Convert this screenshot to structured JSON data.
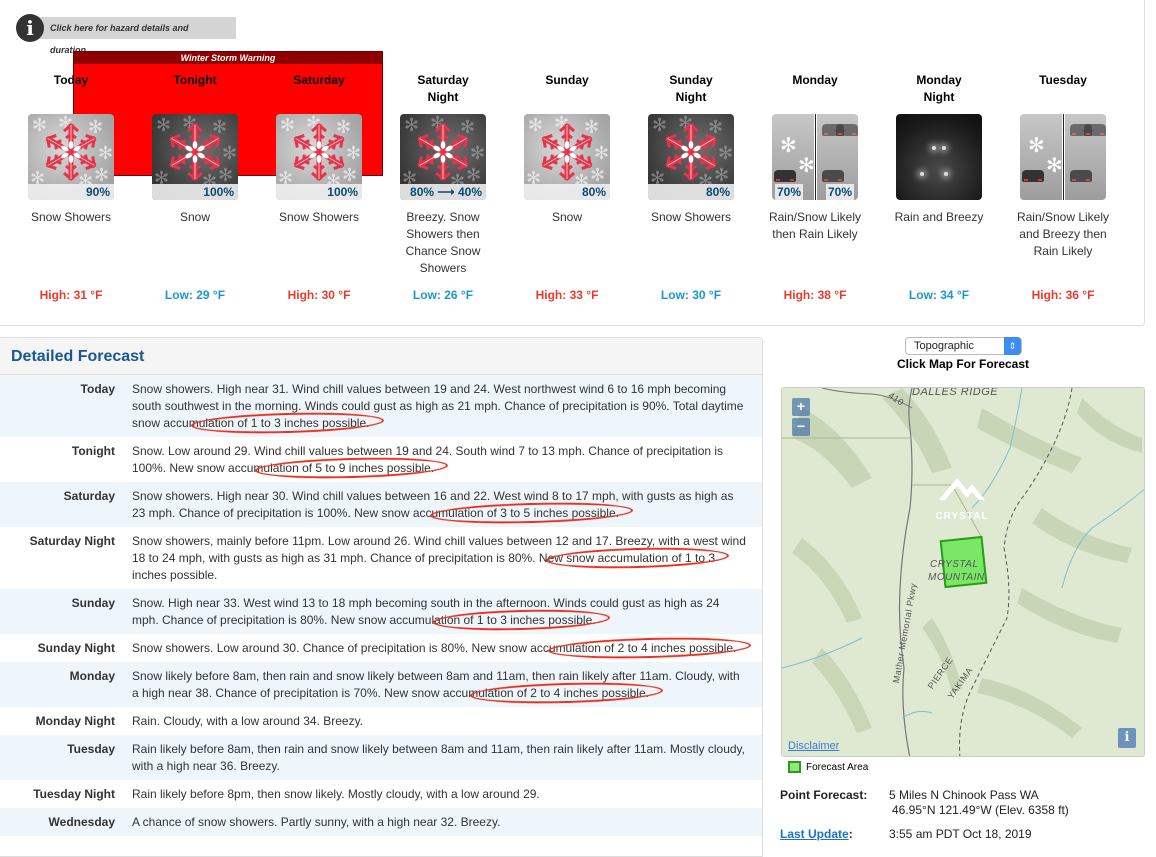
{
  "hazard": {
    "button_label": "Click here for hazard details and duration",
    "warning_title": "Winter Storm Warning",
    "warning_color": "#ff0000"
  },
  "periods": [
    {
      "name": "Today",
      "image": "snow-light",
      "pop": "90%",
      "short_desc": "Snow Showers",
      "temp": "High: 31 °F",
      "temp_type": "high"
    },
    {
      "name": "Tonight",
      "image": "snow-dark",
      "pop": "100%",
      "short_desc": "Snow",
      "temp": "Low: 29 °F",
      "temp_type": "low"
    },
    {
      "name": "Saturday",
      "image": "snow-light",
      "pop": "100%",
      "short_desc": "Snow Showers",
      "temp": "High: 30 °F",
      "temp_type": "high"
    },
    {
      "name": "Saturday Night",
      "image": "snow-dark",
      "pop_from": "80%",
      "pop_to": "40%",
      "short_desc": "Breezy. Snow Showers then Chance Snow Showers",
      "temp": "Low: 26 °F",
      "temp_type": "low"
    },
    {
      "name": "Sunday",
      "image": "snow-light",
      "pop": "80%",
      "short_desc": "Snow",
      "temp": "High: 33 °F",
      "temp_type": "high"
    },
    {
      "name": "Sunday Night",
      "image": "snow-dark",
      "pop": "80%",
      "short_desc": "Snow Showers",
      "temp": "Low: 30 °F",
      "temp_type": "low"
    },
    {
      "name": "Monday",
      "image": "rain-snow-split",
      "pop_left": "70%",
      "pop_right": "70%",
      "short_desc": "Rain/Snow Likely then Rain Likely",
      "temp": "High: 38 °F",
      "temp_type": "high"
    },
    {
      "name": "Monday Night",
      "image": "rain-night",
      "pop": "",
      "short_desc": "Rain and Breezy",
      "temp": "Low: 34 °F",
      "temp_type": "low"
    },
    {
      "name": "Tuesday",
      "image": "rain-snow-split",
      "pop": "",
      "short_desc": "Rain/Snow Likely and Breezy then Rain Likely",
      "temp": "High: 36 °F",
      "temp_type": "high"
    }
  ],
  "detailed": {
    "title": "Detailed Forecast",
    "rows": [
      {
        "label": "Today",
        "text_before": "Snow showers. High near 31. Wind chill values between 19 and 24. West northwest wind 6 to 16 mph becoming south southwest in the morning. Winds could gust as high as 21 mph. Chance of precipitation is 90%. Total daytime snow accum",
        "text_marked": "ulation of 1 to 3 inches possible.",
        "text_after": ""
      },
      {
        "label": "Tonight",
        "text_before": "Snow. Low around 29. Wind chill values between 19 and 24. South wind 7 to 13 mph. Chance of precipitation is 100%. New snow accum",
        "text_marked": "ulation of 5 to 9 inches possible.",
        "text_after": ""
      },
      {
        "label": "Saturday",
        "text_before": "Snow showers. High near 30. Wind chill values between 16 and 22. West wind 8 to 17 mph, with gusts as high as 23 mph. Chance of precipitation is 100%. New snow accu",
        "text_marked": "mulation of 3 to 5 inches possible.",
        "text_after": ""
      },
      {
        "label": "Saturday Night",
        "text_before": "Snow showers, mainly before 11pm. Low around 26. Wind chill values between 12 and 17. Breezy, with a west wind 18 to 24 mph, with gusts as high as 31 mph. Chance of precipitation is 80%. Ne",
        "text_marked": "w snow accumulation of 1 to 3",
        "text_after": " inches possible."
      },
      {
        "label": "Sunday",
        "text_before": "Snow. High near 33. West wind 13 to 18 mph becoming south in the afternoon. Winds could gust as high as 24 mph. Chance of precipitation is 80%. New snow accumula",
        "text_marked": "tion of 1 to 3 inches possible.",
        "text_after": ""
      },
      {
        "label": "Sunday Night",
        "text_before": "Snow showers. Low around 30. Chance of precipitation is 80%. New snow accu",
        "text_marked": "mulation of 2 to 4 inches possible.",
        "text_after": ""
      },
      {
        "label": "Monday",
        "text_before": "Snow likely before 8am, then rain and snow likely between 8am and 11am, then rain likely after 11am. Cloudy, with a high near 38. Chance of precipitation is 70%. New snow accum",
        "text_marked": "ulation of 2 to 4 inches possible.",
        "text_after": ""
      },
      {
        "label": "Monday Night",
        "text_before": "Rain. Cloudy, with a low around 34. Breezy.",
        "text_marked": "",
        "text_after": ""
      },
      {
        "label": "Tuesday",
        "text_before": "Rain likely before 8am, then rain and snow likely between 8am and 11am, then rain likely after 11am. Mostly cloudy, with a high near 36. Breezy.",
        "text_marked": "",
        "text_after": ""
      },
      {
        "label": "Tuesday Night",
        "text_before": "Rain likely before 8pm, then snow likely. Mostly cloudy, with a low around 29.",
        "text_marked": "",
        "text_after": ""
      },
      {
        "label": "Wednesday",
        "text_before": "A chance of snow showers. Partly sunny, with a high near 32. Breezy.",
        "text_marked": "",
        "text_after": ""
      }
    ]
  },
  "map": {
    "layer_select": "Topographic",
    "click_prompt": "Click Map For Forecast",
    "zoom_in": "+",
    "zoom_out": "−",
    "labels": {
      "dalles_ridge": "DALLES RIDGE",
      "route": "410",
      "crystal_logo": "CRYSTAL",
      "crystal_mountain_1": "CRYSTAL",
      "crystal_mountain_2": "MOUNTAIN",
      "parkway": "Mather Memorial Pkwy",
      "pierce": "PIERCE",
      "yakima": "YAKIMA"
    },
    "disclaimer": "Disclaimer",
    "info_button": "i",
    "legend_label": "Forecast Area"
  },
  "point_forecast": {
    "label": "Point Forecast:",
    "location": "5 Miles N Chinook Pass WA",
    "coords": "46.95°N 121.49°W (Elev. 6358 ft)",
    "last_update_label": "Last Update",
    "last_update_colon": ":",
    "last_update_value": "3:55 am PDT Oct 18, 2019"
  }
}
